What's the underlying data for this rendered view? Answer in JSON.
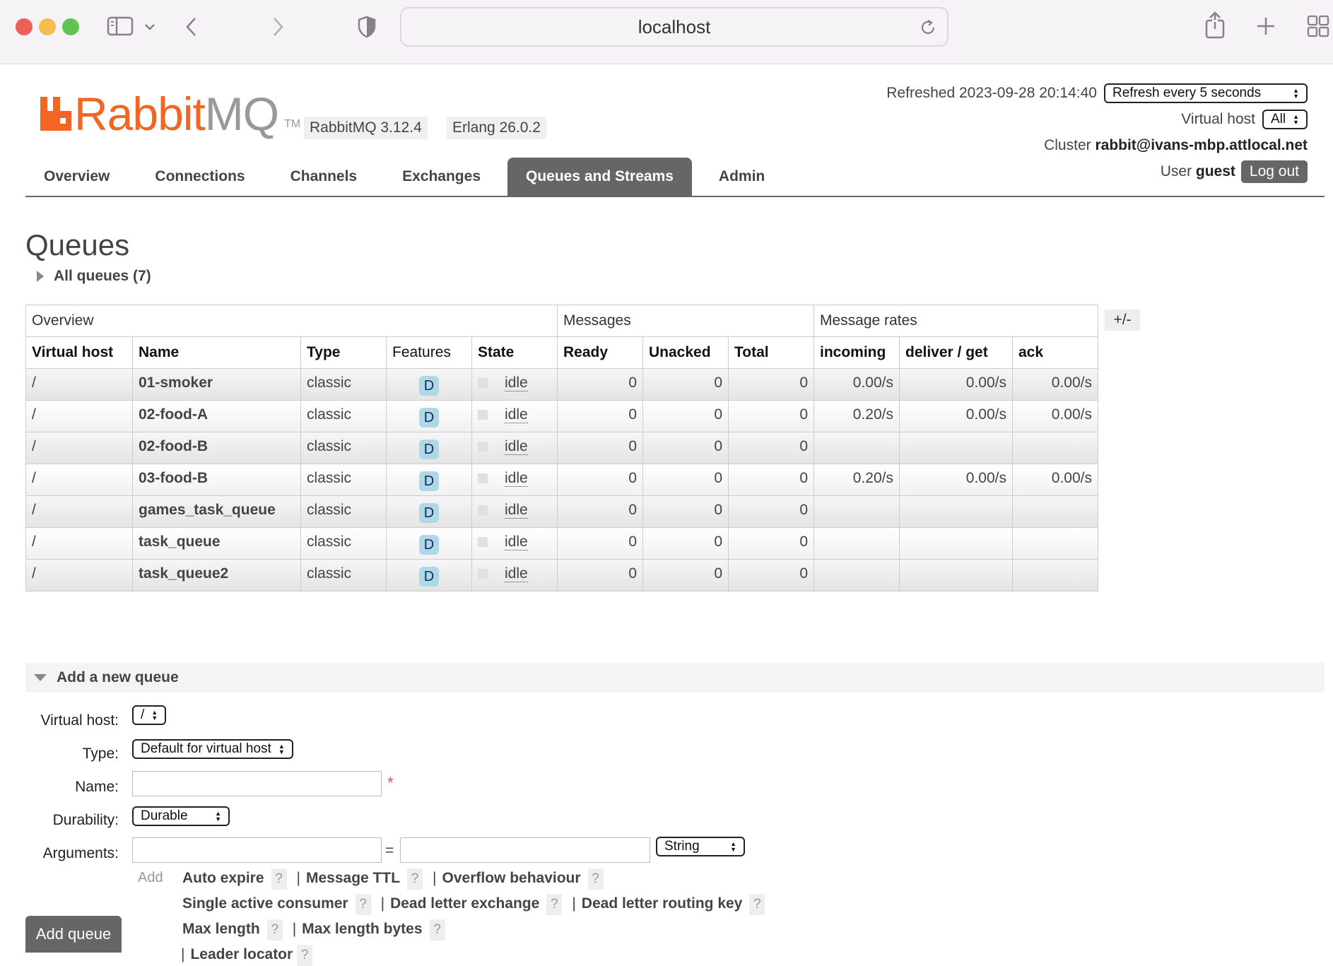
{
  "browser": {
    "url": "localhost"
  },
  "header": {
    "logo_prefix": "Rabbit",
    "logo_suffix": "MQ",
    "logo_tm": "TM",
    "version_rabbit": "RabbitMQ 3.12.4",
    "version_erlang": "Erlang 26.0.2",
    "refreshed_label": "Refreshed 2023-09-28 20:14:40",
    "refresh_select": "Refresh every 5 seconds",
    "vhost_label": "Virtual host",
    "vhost_select": "All",
    "cluster_label": "Cluster",
    "cluster_value": "rabbit@ivans-mbp.attlocal.net",
    "user_label": "User",
    "user_value": "guest",
    "logout": "Log out"
  },
  "tabs": [
    "Overview",
    "Connections",
    "Channels",
    "Exchanges",
    "Queues and Streams",
    "Admin"
  ],
  "page": {
    "title": "Queues",
    "all_queues": "All queues (7)"
  },
  "table": {
    "groups": {
      "overview": "Overview",
      "messages": "Messages",
      "rates": "Message rates"
    },
    "plusminus": "+/-",
    "headers": [
      "Virtual host",
      "Name",
      "Type",
      "Features",
      "State",
      "Ready",
      "Unacked",
      "Total",
      "incoming",
      "deliver / get",
      "ack"
    ],
    "rows": [
      {
        "vhost": "/",
        "name": "01-smoker",
        "type": "classic",
        "feature": "D",
        "state": "idle",
        "ready": "0",
        "unacked": "0",
        "total": "0",
        "incoming": "0.00/s",
        "deliver": "0.00/s",
        "ack": "0.00/s"
      },
      {
        "vhost": "/",
        "name": "02-food-A",
        "type": "classic",
        "feature": "D",
        "state": "idle",
        "ready": "0",
        "unacked": "0",
        "total": "0",
        "incoming": "0.20/s",
        "deliver": "0.00/s",
        "ack": "0.00/s"
      },
      {
        "vhost": "/",
        "name": "02-food-B",
        "type": "classic",
        "feature": "D",
        "state": "idle",
        "ready": "0",
        "unacked": "0",
        "total": "0",
        "incoming": "",
        "deliver": "",
        "ack": ""
      },
      {
        "vhost": "/",
        "name": "03-food-B",
        "type": "classic",
        "feature": "D",
        "state": "idle",
        "ready": "0",
        "unacked": "0",
        "total": "0",
        "incoming": "0.20/s",
        "deliver": "0.00/s",
        "ack": "0.00/s"
      },
      {
        "vhost": "/",
        "name": "games_task_queue",
        "type": "classic",
        "feature": "D",
        "state": "idle",
        "ready": "0",
        "unacked": "0",
        "total": "0",
        "incoming": "",
        "deliver": "",
        "ack": ""
      },
      {
        "vhost": "/",
        "name": "task_queue",
        "type": "classic",
        "feature": "D",
        "state": "idle",
        "ready": "0",
        "unacked": "0",
        "total": "0",
        "incoming": "",
        "deliver": "",
        "ack": ""
      },
      {
        "vhost": "/",
        "name": "task_queue2",
        "type": "classic",
        "feature": "D",
        "state": "idle",
        "ready": "0",
        "unacked": "0",
        "total": "0",
        "incoming": "",
        "deliver": "",
        "ack": ""
      }
    ]
  },
  "form": {
    "section_title": "Add a new queue",
    "vhost_label": "Virtual host:",
    "vhost_value": "/",
    "type_label": "Type:",
    "type_value": "Default for virtual host",
    "name_label": "Name:",
    "name_value": "",
    "required": "*",
    "durability_label": "Durability:",
    "durability_value": "Durable",
    "arguments_label": "Arguments:",
    "equals": "=",
    "arg_type": "String",
    "add": "Add",
    "arg_links": [
      "Auto expire",
      "Message TTL",
      "Overflow behaviour",
      "Single active consumer",
      "Dead letter exchange",
      "Dead letter routing key",
      "Max length",
      "Max length bytes",
      "Leader locator"
    ],
    "help": "?",
    "separator": "|",
    "submit": "Add queue"
  },
  "colors": {
    "brand": "#f26522",
    "active_tab": "#666666",
    "badge": "#add8e6"
  }
}
